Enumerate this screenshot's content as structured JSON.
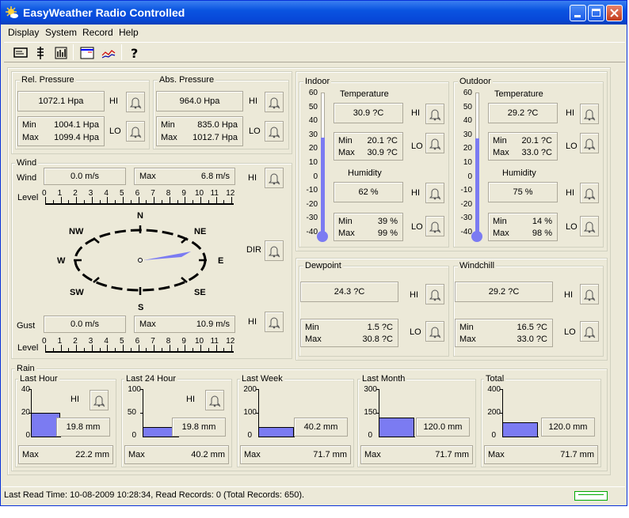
{
  "window": {
    "title": "EasyWeather Radio Controlled"
  },
  "menu": [
    "Display",
    "System",
    "Record",
    "Help"
  ],
  "colors": {
    "accent": "#7b7bf2",
    "titlebar": "#0a54e0",
    "panel": "#ece9d8"
  },
  "pressure": {
    "rel": {
      "legend": "Rel. Pressure",
      "value": "1072.1 Hpa",
      "min_label": "Min",
      "min": "1004.1 Hpa",
      "max_label": "Max",
      "max": "1099.4 Hpa"
    },
    "abs": {
      "legend": "Abs. Pressure",
      "value": "964.0 Hpa",
      "min_label": "Min",
      "min": "835.0 Hpa",
      "max_label": "Max",
      "max": "1012.7 Hpa"
    },
    "hi": "HI",
    "lo": "LO"
  },
  "wind": {
    "legend": "Wind",
    "wind_label": "Wind",
    "wind_value": "0.0 m/s",
    "max_label": "Max",
    "wind_max": "6.8 m/s",
    "level_label": "Level",
    "scale": [
      "0",
      "1",
      "2",
      "3",
      "4",
      "5",
      "6",
      "7",
      "8",
      "9",
      "10",
      "11",
      "12"
    ],
    "compass": [
      "N",
      "NE",
      "E",
      "SE",
      "S",
      "SW",
      "W",
      "NW"
    ],
    "dir_label": "DIR",
    "gust_label": "Gust",
    "gust_value": "0.0 m/s",
    "gust_max": "10.9 m/s",
    "hi": "HI"
  },
  "indoor": {
    "legend": "Indoor",
    "scale": [
      "60",
      "50",
      "40",
      "30",
      "20",
      "10",
      "0",
      "-10",
      "-20",
      "-30",
      "-40"
    ],
    "thermo_level": 0.7,
    "temp_label": "Temperature",
    "temp": "30.9 ?C",
    "temp_min": "20.1 ?C",
    "temp_max": "30.9 ?C",
    "hum_label": "Humidity",
    "hum": "62 %",
    "hum_min": "39 %",
    "hum_max": "99 %"
  },
  "outdoor": {
    "legend": "Outdoor",
    "scale": [
      "60",
      "50",
      "40",
      "30",
      "20",
      "10",
      "0",
      "-10",
      "-20",
      "-30",
      "-40"
    ],
    "thermo_level": 0.692,
    "temp_label": "Temperature",
    "temp": "29.2 ?C",
    "temp_min": "20.1 ?C",
    "temp_max": "33.0 ?C",
    "hum_label": "Humidity",
    "hum": "75 %",
    "hum_min": "14 %",
    "hum_max": "98 %"
  },
  "dewpoint": {
    "legend": "Dewpoint",
    "value": "24.3 ?C",
    "min": "1.5 ?C",
    "max": "30.8 ?C"
  },
  "windchill": {
    "legend": "Windchill",
    "value": "29.2 ?C",
    "min": "16.5 ?C",
    "max": "33.0 ?C"
  },
  "labels": {
    "min": "Min",
    "max": "Max",
    "hi": "HI",
    "lo": "LO"
  },
  "rain": {
    "legend": "Rain",
    "panels": [
      {
        "legend": "Last Hour",
        "scale": [
          "40",
          "20",
          "0"
        ],
        "level": 0.495,
        "value": "19.8 mm",
        "max": "22.2 mm"
      },
      {
        "legend": "Last 24 Hour",
        "scale": [
          "100",
          "50",
          "0"
        ],
        "level": 0.198,
        "value": "19.8 mm",
        "max": "40.2 mm"
      },
      {
        "legend": "Last Week",
        "scale": [
          "200",
          "100",
          "0"
        ],
        "level": 0.201,
        "value": "40.2 mm",
        "max": "71.7 mm"
      },
      {
        "legend": "Last Month",
        "scale": [
          "300",
          "150",
          "0"
        ],
        "level": 0.4,
        "value": "120.0 mm",
        "max": "71.7 mm"
      },
      {
        "legend": "Total",
        "scale": [
          "400",
          "200",
          "0"
        ],
        "level": 0.3,
        "value": "120.0 mm",
        "max": "71.7 mm"
      }
    ]
  },
  "status": "Last Read Time: 10-08-2009 10:28:34, Read Records: 0 (Total Records: 650)."
}
